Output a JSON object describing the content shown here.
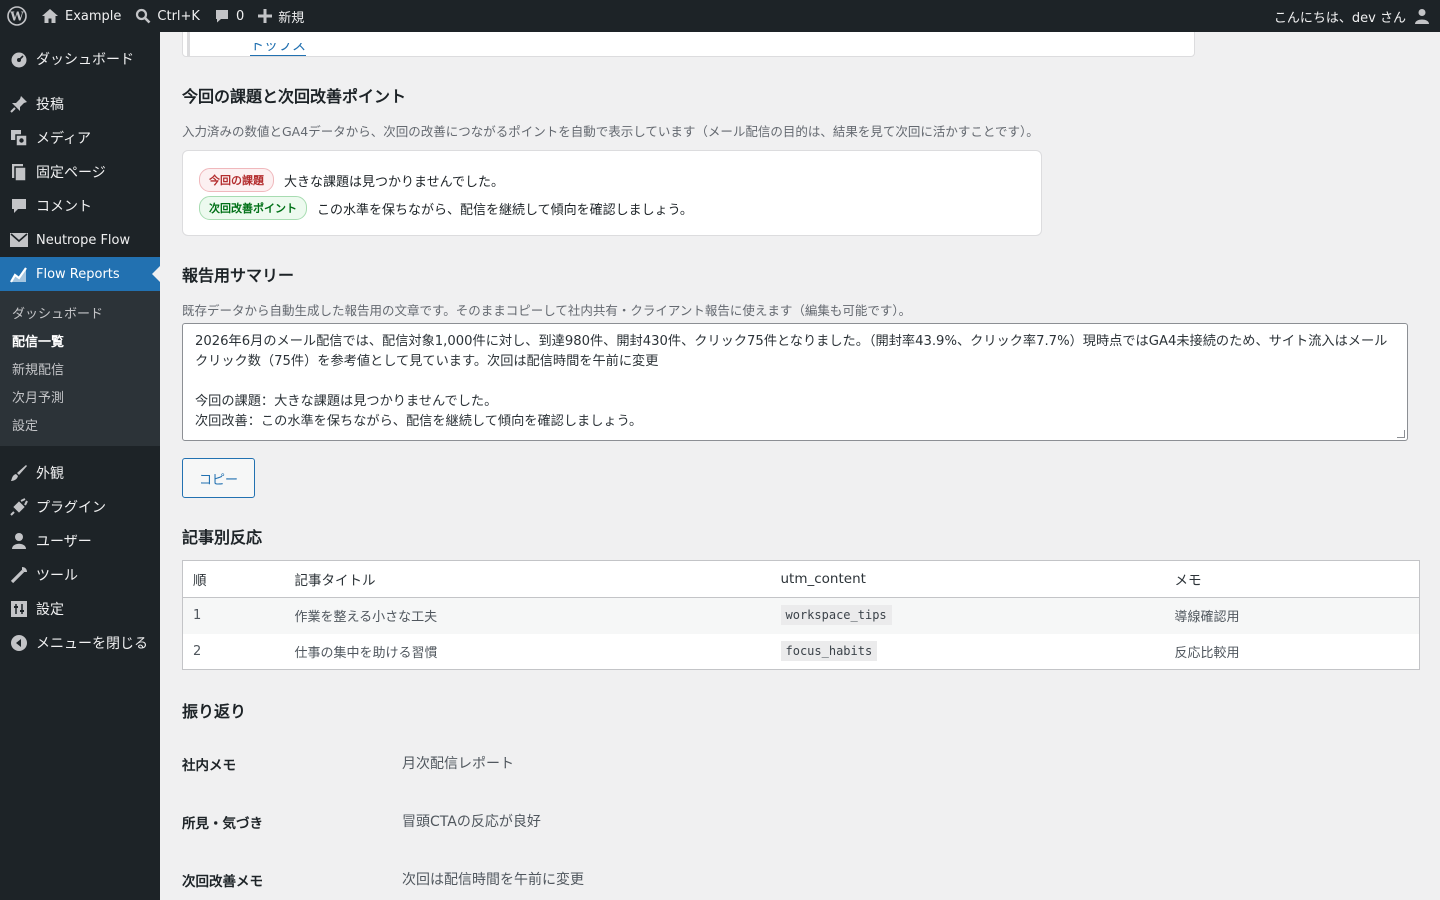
{
  "adminbar": {
    "site_name": "Example",
    "search_shortcut": "Ctrl+K",
    "comments_count": "0",
    "new_label": "新規",
    "greeting": "こんにちは、dev さん"
  },
  "sidebar": {
    "items_top": [
      {
        "label": "ダッシュボード",
        "icon": "dashboard-icon"
      },
      {
        "label": "投稿",
        "icon": "pin-icon"
      },
      {
        "label": "メディア",
        "icon": "media-icon"
      },
      {
        "label": "固定ページ",
        "icon": "page-icon"
      },
      {
        "label": "コメント",
        "icon": "comment-icon"
      },
      {
        "label": "Neutrope Flow",
        "icon": "mail-icon"
      },
      {
        "label": "Flow Reports",
        "icon": "chart-icon"
      }
    ],
    "submenu": [
      "ダッシュボード",
      "配信一覧",
      "新規配信",
      "次月予測",
      "設定"
    ],
    "items_bottom": [
      {
        "label": "外観",
        "icon": "brush-icon"
      },
      {
        "label": "プラグイン",
        "icon": "plugin-icon"
      },
      {
        "label": "ユーザー",
        "icon": "user-icon"
      },
      {
        "label": "ツール",
        "icon": "wrench-icon"
      },
      {
        "label": "設定",
        "icon": "settings-icon"
      },
      {
        "label": "メニューを閉じる",
        "icon": "collapse-icon"
      }
    ]
  },
  "top_card": {
    "link_text": "トップス"
  },
  "issues": {
    "title": "今回の課題と次回改善ポイント",
    "description": "入力済みの数値とGA4データから、次回の改善につながるポイントを自動で表示しています（メール配信の目的は、結果を見て次回に活かすことです）。",
    "issue_badge": "今回の課題",
    "issue_text": "大きな課題は見つかりませんでした。",
    "next_badge": "次回改善ポイント",
    "next_text": "この水準を保ちながら、配信を継続して傾向を確認しましょう。"
  },
  "summary": {
    "title": "報告用サマリー",
    "description": "既存データから自動生成した報告用の文章です。そのままコピーして社内共有・クライアント報告に使えます（編集も可能です）。",
    "text": "2026年6月のメール配信では、配信対象1,000件に対し、到達980件、開封430件、クリック75件となりました。（開封率43.9%、クリック率7.7%）現時点ではGA4未接続のため、サイト流入はメールクリック数（75件）を参考値として見ています。次回は配信時間を午前に変更\n\n今回の課題：大きな課題は見つかりませんでした。\n次回改善：この水準を保ちながら、配信を継続して傾向を確認しましょう。",
    "copy_label": "コピー"
  },
  "articles": {
    "title": "記事別反応",
    "headers": [
      "順",
      "記事タイトル",
      "utm_content",
      "メモ"
    ],
    "rows": [
      {
        "rank": "1",
        "title": "作業を整える小さな工夫",
        "utm": "workspace_tips",
        "memo": "導線確認用"
      },
      {
        "rank": "2",
        "title": "仕事の集中を助ける習慣",
        "utm": "focus_habits",
        "memo": "反応比較用"
      }
    ]
  },
  "review": {
    "title": "振り返り",
    "rows": [
      {
        "label": "社内メモ",
        "value": "月次配信レポート"
      },
      {
        "label": "所見・気づき",
        "value": "冒頭CTAの反応が良好"
      },
      {
        "label": "次回改善メモ",
        "value": "次回は配信時間を午前に変更"
      }
    ]
  }
}
